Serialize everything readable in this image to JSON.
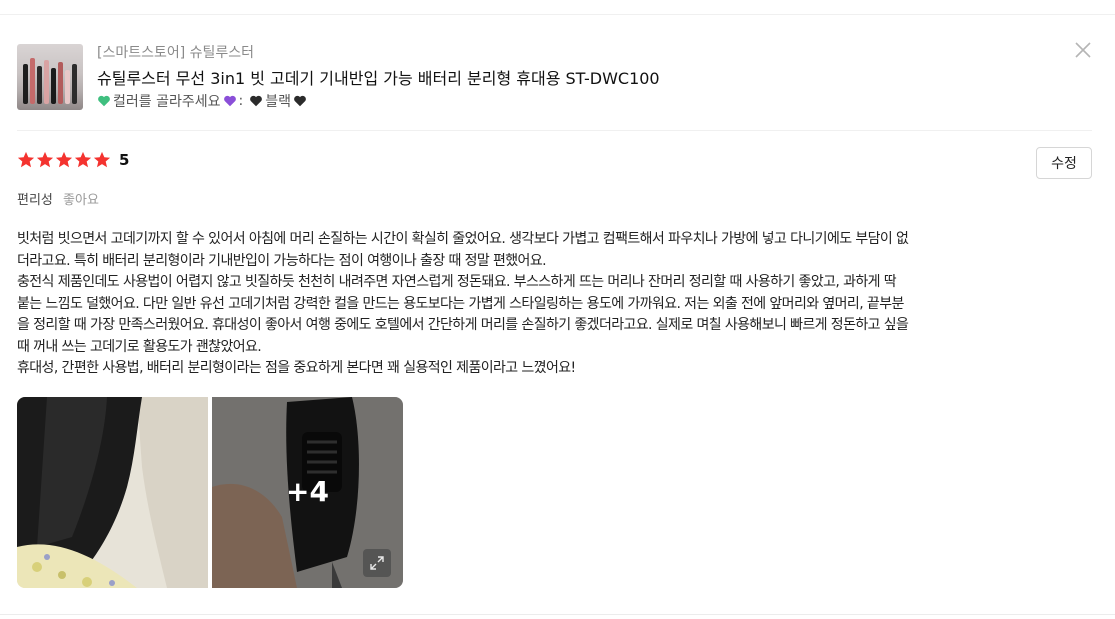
{
  "product": {
    "store": "[스마트스토어] 슈틸루스터",
    "title": "슈틸루스터 무선 3in1 빗 고데기 기내반입 가능 배터리 분리형 휴대용 ST-DWC100",
    "option_label": "컬러를 골라주세요",
    "option_separator": ":",
    "option_value": "블랙",
    "heart_colors": [
      "#3fbf7f",
      "#8a4fd8",
      "#2b2b2b"
    ]
  },
  "review": {
    "stars_count": 5,
    "star_color": "#f4332f",
    "score": "5",
    "edit_label": "수정",
    "attribute_key": "편리성",
    "attribute_value": "좋아요",
    "lines": [
      "빗처럼 빗으면서 고데기까지 할 수 있어서 아침에 머리 손질하는 시간이 확실히 줄었어요. 생각보다 가볍고 컴팩트해서 파우치나 가방에 넣고 다니기에도 부담이 없",
      "더라고요. 특히 배터리 분리형이라 기내반입이 가능하다는 점이 여행이나 출장 때 정말 편했어요.",
      "충전식 제품인데도 사용법이 어렵지 않고 빗질하듯 천천히 내려주면 자연스럽게 정돈돼요. 부스스하게 뜨는 머리나 잔머리 정리할 때 사용하기 좋았고, 과하게 딱",
      "붙는 느낌도 덜했어요. 다만 일반 유선 고데기처럼 강력한 컬을 만드는 용도보다는 가볍게 스타일링하는 용도에 가까워요. 저는 외출 전에 앞머리와 옆머리, 끝부분",
      "을 정리할 때 가장 만족스러웠어요. 휴대성이 좋아서 여행 중에도 호텔에서 간단하게 머리를 손질하기 좋겠더라고요. 실제로 며칠 사용해보니 빠르게 정돈하고 싶을",
      "때 꺼내 쓰는 고데기로 활용도가 괜찮았어요.",
      "휴대성, 간편한 사용법, 배터리 분리형이라는 점을 중요하게 본다면 꽤 실용적인 제품이라고 느꼈어요!"
    ],
    "more_photos": "+4"
  },
  "icons": {
    "close": "close-icon",
    "expand": "expand-icon",
    "star": "star-icon",
    "heart": "heart-icon"
  }
}
